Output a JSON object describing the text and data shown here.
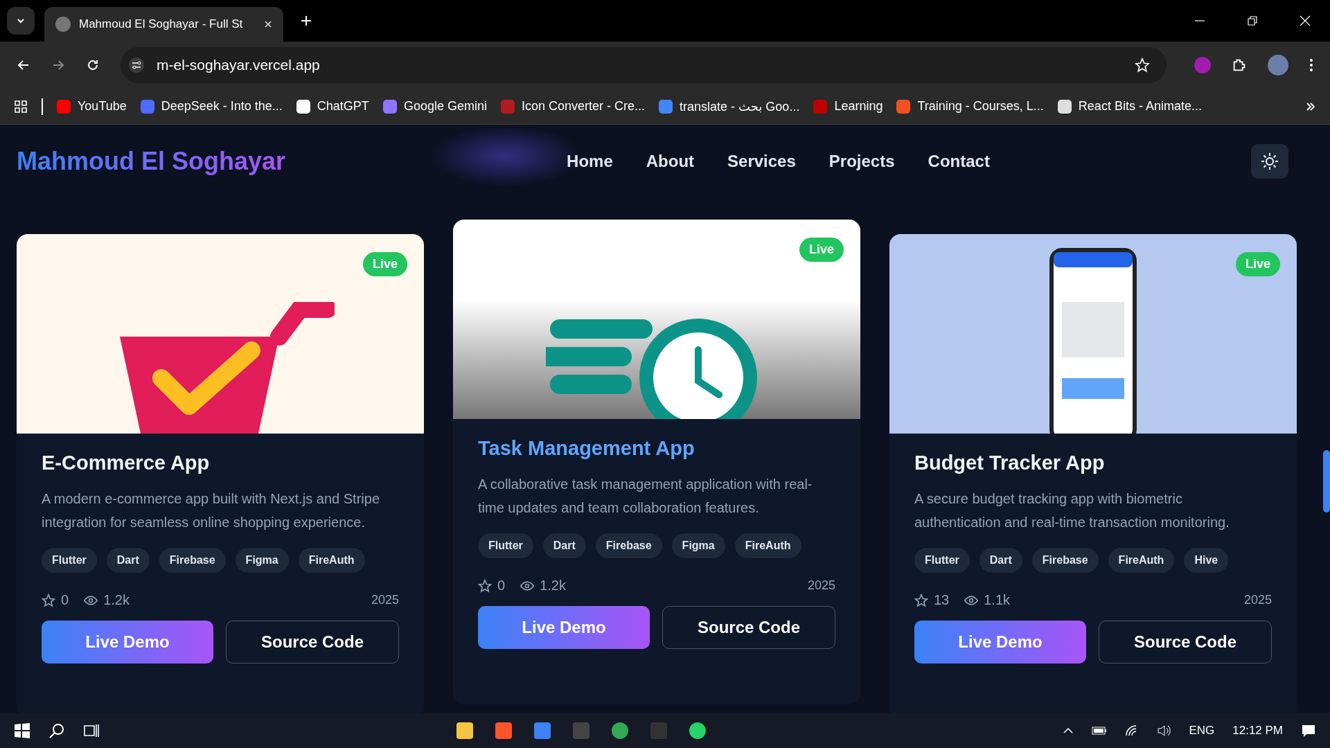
{
  "browser": {
    "tabs": [
      {
        "title": "Mahmoud El Soghayar - Full St",
        "selected": true
      }
    ],
    "address": "m-el-soghayar.vercel.app",
    "bookmarks": [
      "YouTube",
      "DeepSeek - Into the...",
      "ChatGPT",
      "Google Gemini",
      "Icon Converter - Cre...",
      "translate - بحث Goo...",
      "Learning",
      "Training - Courses, L...",
      "React Bits - Animate..."
    ]
  },
  "page": {
    "brand": "Mahmoud El Soghayar",
    "nav": [
      {
        "label": "Home"
      },
      {
        "label": "About"
      },
      {
        "label": "Services"
      },
      {
        "label": "Projects"
      },
      {
        "label": "Contact"
      }
    ],
    "projects": [
      {
        "title": "E-Commerce App",
        "kind": "cart",
        "status": "Live",
        "highlighted": false,
        "description": "A modern e-commerce app built with Next.js and Stripe integration for seamless online shopping experience.",
        "tags": [
          "Flutter",
          "Dart",
          "Firebase",
          "Figma",
          "FireAuth"
        ],
        "stars": "0",
        "views": "1.2k",
        "year": "2025",
        "demo": "Live Demo",
        "source": "Source Code"
      },
      {
        "title": "Task Management App",
        "kind": "clock",
        "status": "Live",
        "highlighted": true,
        "description": "A collaborative task management application with real-time updates and team collaboration features.",
        "tags": [
          "Flutter",
          "Dart",
          "Firebase",
          "Figma",
          "FireAuth"
        ],
        "stars": "0",
        "views": "1.2k",
        "year": "2025",
        "demo": "Live Demo",
        "source": "Source Code"
      },
      {
        "title": "Budget Tracker App",
        "kind": "phone",
        "status": "Live",
        "highlighted": false,
        "description": "A secure budget tracking app with biometric authentication and real-time transaction monitoring.",
        "tags": [
          "Flutter",
          "Dart",
          "Firebase",
          "FireAuth",
          "Hive"
        ],
        "stars": "13",
        "views": "1.1k",
        "year": "2025",
        "demo": "Live Demo",
        "source": "Source Code"
      }
    ]
  },
  "taskbar": {
    "language": "ENG",
    "time": "12:12 PM"
  }
}
